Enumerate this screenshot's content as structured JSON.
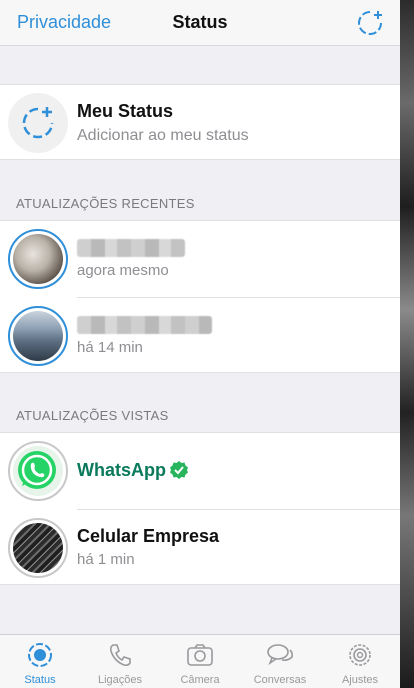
{
  "header": {
    "left_link": "Privacidade",
    "title": "Status"
  },
  "my_status": {
    "title": "Meu Status",
    "subtitle": "Adicionar ao meu status"
  },
  "recent": {
    "section_title": "ATUALIZAÇÕES RECENTES",
    "items": [
      {
        "time": "agora mesmo"
      },
      {
        "time": "há 14 min"
      }
    ]
  },
  "viewed": {
    "section_title": "ATUALIZAÇÕES VISTAS",
    "items": [
      {
        "name": "WhatsApp",
        "time": ""
      },
      {
        "name": "Celular Empresa",
        "time": "há 1 min"
      }
    ]
  },
  "tabs": [
    {
      "label": "Status",
      "icon": "status-icon"
    },
    {
      "label": "Ligações",
      "icon": "phone-icon"
    },
    {
      "label": "Câmera",
      "icon": "camera-icon"
    },
    {
      "label": "Conversas",
      "icon": "chats-icon"
    },
    {
      "label": "Ajustes",
      "icon": "gear-icon"
    }
  ],
  "colors": {
    "accent": "#2f8fd8",
    "whatsapp_green": "#25d366",
    "verified_green": "#28b45c"
  }
}
